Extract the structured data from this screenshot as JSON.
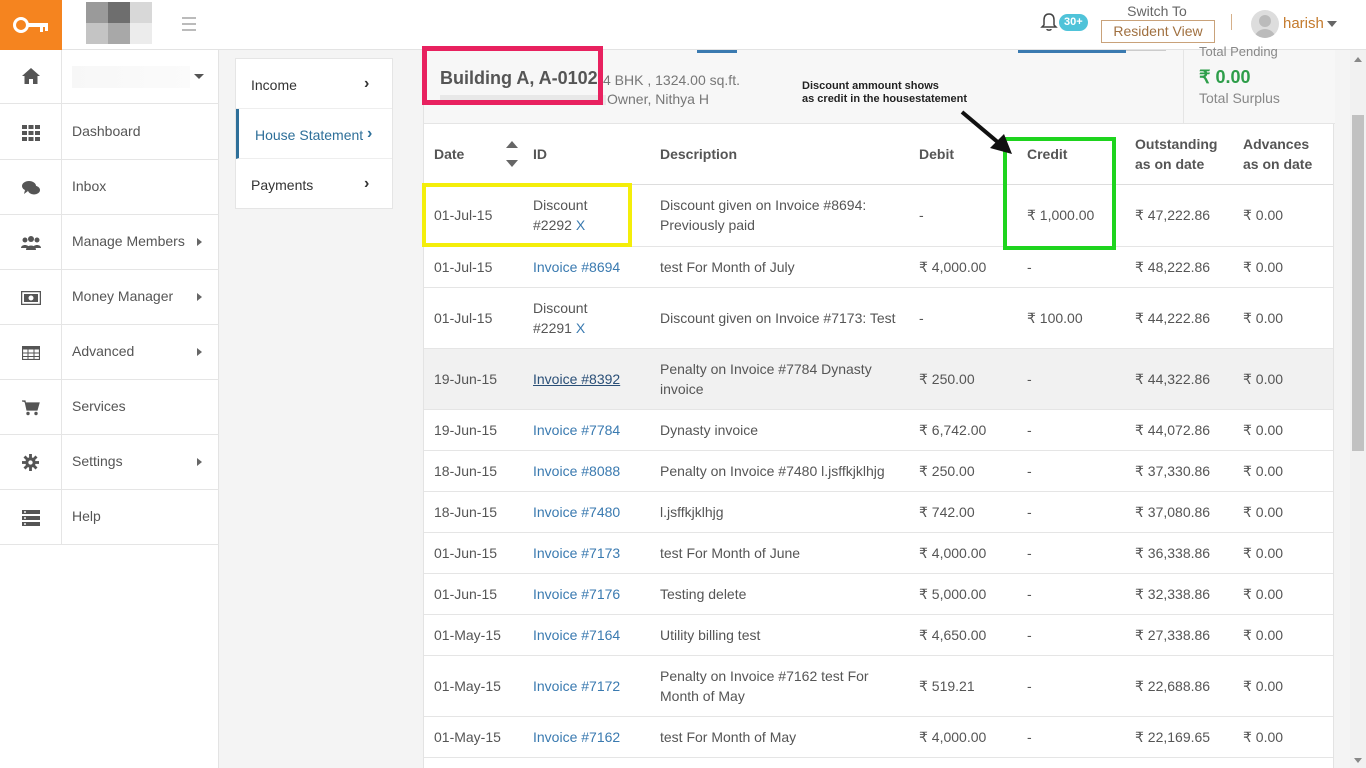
{
  "topbar": {
    "notifications_badge": "30+",
    "switch_to_label": "Switch To",
    "resident_view_label": "Resident View",
    "username": "harish"
  },
  "sidebar": {
    "items": [
      {
        "label": "Dashboard",
        "icon": "grid-icon"
      },
      {
        "label": "Inbox",
        "icon": "chat-icon"
      },
      {
        "label": "Manage Members",
        "icon": "users-icon"
      },
      {
        "label": "Money Manager",
        "icon": "money-icon"
      },
      {
        "label": "Advanced",
        "icon": "table-icon"
      },
      {
        "label": "Services",
        "icon": "cart-icon"
      },
      {
        "label": "Settings",
        "icon": "gear-icon"
      },
      {
        "label": "Help",
        "icon": "help-icon"
      }
    ]
  },
  "subnav": {
    "items": [
      {
        "label": "Income"
      },
      {
        "label": "House Statement"
      },
      {
        "label": "Payments"
      }
    ]
  },
  "header": {
    "building": "Building A, A-0102",
    "details": "4 BHK , 1324.00 sq.ft.",
    "owner": "Owner, Nithya H",
    "total_pending_label": "Total Pending",
    "surplus_amount": "₹ 0.00",
    "surplus_label": "Total Surplus"
  },
  "annotation": {
    "line1": "Discount ammount shows",
    "line2": "as credit in the housestatement"
  },
  "table": {
    "columns": {
      "date": "Date",
      "id": "ID",
      "description": "Description",
      "debit": "Debit",
      "credit": "Credit",
      "outstanding_1": "Outstanding",
      "outstanding_2": "as on date",
      "advances_1": "Advances",
      "advances_2": "as on date"
    },
    "rows": [
      {
        "date": "01-Jul-15",
        "id1": "Discount",
        "id2": "#2292",
        "x": "X",
        "desc": "Discount given on Invoice #8694: Previously paid",
        "debit": "-",
        "credit": "₹ 1,000.00",
        "outstanding": "₹ 47,222.86",
        "advances": "₹ 0.00"
      },
      {
        "date": "01-Jul-15",
        "id": "Invoice #8694",
        "desc": "test For Month of July",
        "debit": "₹ 4,000.00",
        "credit": "-",
        "outstanding": "₹ 48,222.86",
        "advances": "₹ 0.00"
      },
      {
        "date": "01-Jul-15",
        "id1": "Discount",
        "id2": "#2291",
        "x": "X",
        "desc": "Discount given on Invoice #7173: Test",
        "debit": "-",
        "credit": "₹ 100.00",
        "outstanding": "₹ 44,222.86",
        "advances": "₹ 0.00"
      },
      {
        "date": "19-Jun-15",
        "id": "Invoice #8392",
        "desc": "Penalty on Invoice #7784 Dynasty invoice",
        "debit": "₹ 250.00",
        "credit": "-",
        "outstanding": "₹ 44,322.86",
        "advances": "₹ 0.00"
      },
      {
        "date": "19-Jun-15",
        "id": "Invoice #7784",
        "desc": "Dynasty invoice",
        "debit": "₹ 6,742.00",
        "credit": "-",
        "outstanding": "₹ 44,072.86",
        "advances": "₹ 0.00"
      },
      {
        "date": "18-Jun-15",
        "id": "Invoice #8088",
        "desc": "Penalty on Invoice #7480 l.jsffkjklhjg",
        "debit": "₹ 250.00",
        "credit": "-",
        "outstanding": "₹ 37,330.86",
        "advances": "₹ 0.00"
      },
      {
        "date": "18-Jun-15",
        "id": "Invoice #7480",
        "desc": "l.jsffkjklhjg",
        "debit": "₹ 742.00",
        "credit": "-",
        "outstanding": "₹ 37,080.86",
        "advances": "₹ 0.00"
      },
      {
        "date": "01-Jun-15",
        "id": "Invoice #7173",
        "desc": "test For Month of June",
        "debit": "₹ 4,000.00",
        "credit": "-",
        "outstanding": "₹ 36,338.86",
        "advances": "₹ 0.00"
      },
      {
        "date": "01-Jun-15",
        "id": "Invoice #7176",
        "desc": "Testing delete",
        "debit": "₹ 5,000.00",
        "credit": "-",
        "outstanding": "₹ 32,338.86",
        "advances": "₹ 0.00"
      },
      {
        "date": "01-May-15",
        "id": "Invoice #7164",
        "desc": "Utility billing test",
        "debit": "₹ 4,650.00",
        "credit": "-",
        "outstanding": "₹ 27,338.86",
        "advances": "₹ 0.00"
      },
      {
        "date": "01-May-15",
        "id": "Invoice #7172",
        "desc": "Penalty on Invoice #7162 test For Month of May",
        "debit": "₹ 519.21",
        "credit": "-",
        "outstanding": "₹ 22,688.86",
        "advances": "₹ 0.00"
      },
      {
        "date": "01-May-15",
        "id": "Invoice #7162",
        "desc": "test For Month of May",
        "debit": "₹ 4,000.00",
        "credit": "-",
        "outstanding": "₹ 22,169.65",
        "advances": "₹ 0.00"
      }
    ]
  },
  "colors": {
    "accent_orange": "#f5841f",
    "link_blue": "#3a7ab0",
    "surplus_green": "#2e9e4a",
    "highlight_red": "#e8215f",
    "highlight_yellow": "#f4ee0a",
    "highlight_green": "#1ed41e"
  }
}
